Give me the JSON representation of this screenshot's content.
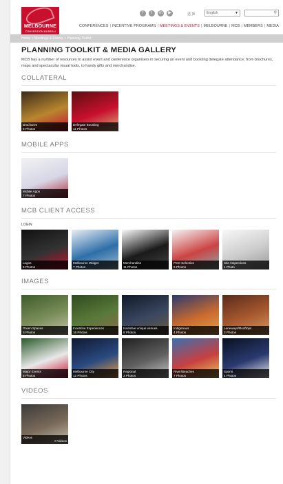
{
  "header": {
    "logo_text": "MELBOURNE",
    "logo_sub": "CONVENTION BUREAU",
    "social_icons": [
      "facebook-icon",
      "twitter-icon",
      "linkedin-icon",
      "youtube-icon"
    ],
    "lang_label": "选 择",
    "lang_value": "English",
    "search_placeholder": ""
  },
  "nav": {
    "items": [
      "CONFERENCES",
      "INCENTIVE PROGRAMS",
      "MEETINGS & EVENTS",
      "MELBOURNE",
      "MCB",
      "MEMBERS",
      "MEDIA"
    ],
    "active_index": 2
  },
  "breadcrumb": "Home > Meetings & Events > Planning Toolkit",
  "page": {
    "title": "PLANNING TOOLKIT & MEDIA GALLERY",
    "intro": "MCB has a number of resources to assist event and conference organisers in securing an event and boosting delegate attendance; from brochures, maps and spectacular visual tools, to handy gifts and merchandise."
  },
  "sections": {
    "collateral": {
      "title": "COLLATERAL",
      "tiles": [
        {
          "name": "Brochures",
          "count": "6 Photos",
          "colors": [
            "#3b2a1a",
            "#b8862f",
            "#c8102e"
          ]
        },
        {
          "name": "Delegate Boosting",
          "count": "11 Photos",
          "colors": [
            "#5a1010",
            "#c8102e",
            "#d8b080"
          ]
        }
      ]
    },
    "mobile": {
      "title": "MOBILE APPS",
      "tiles": [
        {
          "name": "Mobile Apps",
          "count": "7 Photos",
          "colors": [
            "#f2f2f2",
            "#d6d6e6",
            "#b03040"
          ]
        }
      ]
    },
    "client": {
      "title": "MCB CLIENT ACCESS",
      "login": "LOGIN",
      "tiles": [
        {
          "name": "Logos",
          "count": "9 Photos",
          "colors": [
            "#111",
            "#333",
            "#c8102e"
          ]
        },
        {
          "name": "Melbourne Widget",
          "count": "7 Photos",
          "colors": [
            "#e8eef5",
            "#2e6fa8",
            "#9cb8d0"
          ]
        },
        {
          "name": "Merchandise",
          "count": "11 Photos",
          "colors": [
            "#fafafa",
            "#1a1a1a",
            "#444"
          ]
        },
        {
          "name": "PCO Selection",
          "count": "6 Photos",
          "colors": [
            "#f4f4f4",
            "#c44",
            "#8aa"
          ]
        },
        {
          "name": "Site Inspections",
          "count": "1 Photo",
          "colors": [
            "#f8f8f8",
            "#ccc",
            "#999"
          ]
        }
      ]
    },
    "images": {
      "title": "IMAGES",
      "tiles": [
        {
          "name": "Green Spaces",
          "count": "3 Photos",
          "colors": [
            "#3d5a2a",
            "#7a8e5a",
            "#c9c4a8"
          ]
        },
        {
          "name": "Incentive Experiences",
          "count": "16 Photos",
          "colors": [
            "#2e4a20",
            "#5a7a3a",
            "#8a6a4a"
          ]
        },
        {
          "name": "Incentive unique venues",
          "count": "8 Photos",
          "colors": [
            "#101828",
            "#3a4860",
            "#6a5a40"
          ]
        },
        {
          "name": "Indigenous",
          "count": "4 Photos",
          "colors": [
            "#2a3a70",
            "#c86a30",
            "#e8a048"
          ]
        },
        {
          "name": "Laneways/Rooftops",
          "count": "3 Photos",
          "colors": [
            "#5a2a1a",
            "#a85a30",
            "#d89a60"
          ]
        },
        {
          "name": "Major Events",
          "count": "8 Photos",
          "colors": [
            "#2a5a2a",
            "#e8e8e8",
            "#c8102e"
          ]
        },
        {
          "name": "Melbourne City",
          "count": "12 Photos",
          "colors": [
            "#101830",
            "#2a4a80",
            "#e8a040"
          ]
        },
        {
          "name": "Regional",
          "count": "3 Photos",
          "colors": [
            "#202020",
            "#606060",
            "#c8c8c8"
          ]
        },
        {
          "name": "River/Beaches",
          "count": "7 Photos",
          "colors": [
            "#3a70b0",
            "#c84040",
            "#e8c860"
          ]
        },
        {
          "name": "Sports",
          "count": "4 Photos",
          "colors": [
            "#0a1020",
            "#2a3a70",
            "#f0f0f0"
          ]
        }
      ]
    },
    "videos": {
      "title": "VIDEOS",
      "tiles": [
        {
          "name": "Videos",
          "count": "0 Videos",
          "colors": [
            "#3a3a3a",
            "#7a6a5a",
            "#c8c0b0"
          ]
        }
      ]
    }
  }
}
